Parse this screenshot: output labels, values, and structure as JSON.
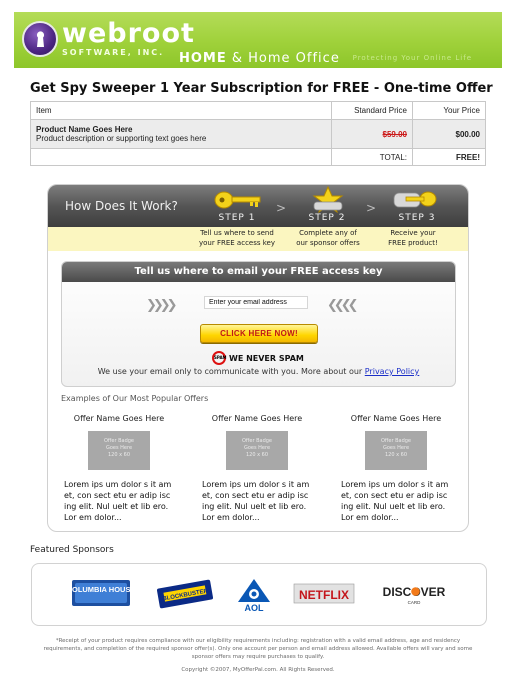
{
  "header": {
    "brand": "webroot",
    "brand_sub": "SOFTWARE, INC.",
    "tagline_bold": "HOME",
    "tagline_rest": " & Home Office",
    "tagline_faint": "Protecting Your Online Life",
    "colors": {
      "banner": "#9fd13a",
      "logo": "#4c2582"
    }
  },
  "offer_title": "Get Spy Sweeper 1 Year Subscription for FREE - One-time Offer",
  "order_table": {
    "headers": [
      "Item",
      "Standard Price",
      "Your Price"
    ],
    "product_name": "Product Name Goes Here",
    "product_desc": "Product description or supporting text goes here",
    "standard_price": "$59.00",
    "your_price": "$00.00",
    "total_label": "TOTAL:",
    "total_value": "FREE!"
  },
  "how_it_works": {
    "title": "How Does It Work?",
    "steps": [
      {
        "label": "STEP 1",
        "text_line1": "Tell us where to send",
        "text_line2": "your FREE access key",
        "icon": "key-icon"
      },
      {
        "label": "STEP 2",
        "text_line1": "Complete any of",
        "text_line2": "our sponsor offers",
        "icon": "star-hand-icon"
      },
      {
        "label": "STEP 3",
        "text_line1": "Receive your",
        "text_line2": "FREE product!",
        "icon": "hand-key-icon"
      }
    ],
    "arrow": ">"
  },
  "email_form": {
    "heading": "Tell us where to email your FREE access key",
    "placeholder": "Enter your email address",
    "left_chevrons": "❯❯❯❯",
    "right_chevrons": "❮❮❮❮",
    "button_label": "CLICK HERE NOW!",
    "spam_icon_text": "SPAM",
    "spam_text": "WE NEVER SPAM",
    "privacy_text": "We use your email only to communicate with you. More about our ",
    "privacy_link": "Privacy Policy"
  },
  "examples": {
    "title": "Examples of Our Most Popular Offers",
    "offers": [
      {
        "name": "Offer Name Goes Here",
        "badge_line1": "Offer Badge",
        "badge_line2": "Goes Here",
        "badge_line3": "120 x 60",
        "desc": "Lorem ips um dolor s it am et, con sect etu er adip isc ing elit. Nul uelt et lib ero. Lor em dolor..."
      },
      {
        "name": "Offer Name Goes Here",
        "badge_line1": "Offer Badge",
        "badge_line2": "Goes Here",
        "badge_line3": "120 x 60",
        "desc": "Lorem ips um dolor s it am et, con sect etu er adip isc ing elit. Nul uelt et lib ero. Lor em dolor..."
      },
      {
        "name": "Offer Name Goes Here",
        "badge_line1": "Offer Badge",
        "badge_line2": "Goes Here",
        "badge_line3": "120 x 60",
        "desc": "Lorem ips um dolor s it am et, con sect etu er adip isc ing elit. Nul uelt et lib ero. Lor em dolor..."
      }
    ]
  },
  "sponsors": {
    "title": "Featured Sponsors",
    "items": [
      {
        "name": "COLUMBIA HOUSE",
        "icon": "columbia-house-logo"
      },
      {
        "name": "BLOCKBUSTER",
        "icon": "blockbuster-logo"
      },
      {
        "name": "AOL",
        "icon": "aol-logo"
      },
      {
        "name": "NETFLIX",
        "icon": "netflix-logo"
      },
      {
        "name": "DISCOVER",
        "sub": "CARD",
        "icon": "discover-card-logo"
      }
    ]
  },
  "footer": {
    "disclaimer": "*Receipt of your product requires compliance with our eligibility requirements including: registration with a valid email address, age and residency requirements, and completion of the required sponsor offer(s). Only one account per person and email address allowed. Available offers will vary and some sponsor offers may require purchases to qualify.",
    "copyright": "Copyright ©2007, MyOfferPal.com. All Rights Reserved."
  }
}
